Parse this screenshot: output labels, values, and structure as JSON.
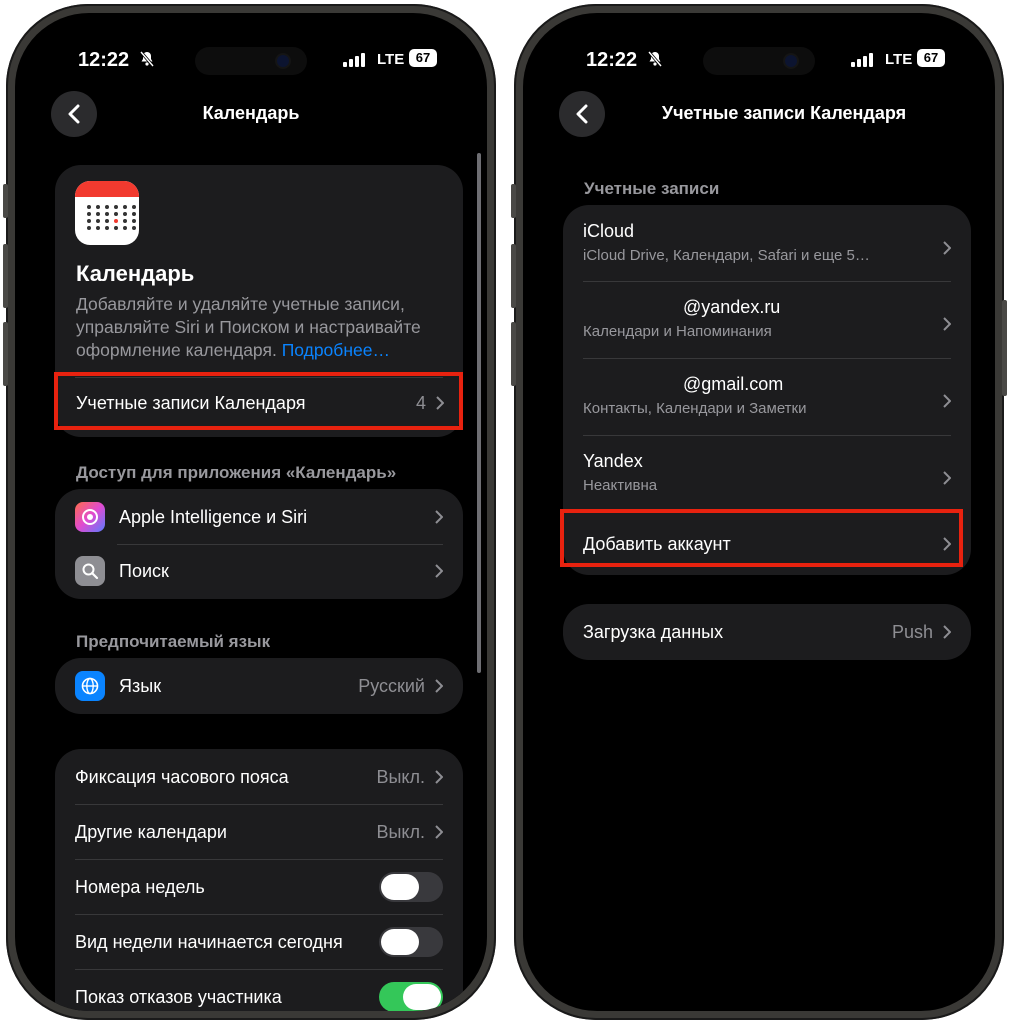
{
  "status": {
    "time": "12:22",
    "network": "LTE",
    "battery": "67"
  },
  "left": {
    "nav_title": "Календарь",
    "app_title": "Календарь",
    "description": "Добавляйте и удаляйте учетные записи, управляйте Siri и Поиском и настраивайте оформление календаря.",
    "more_link": "Подробнее…",
    "accounts_row": {
      "label": "Учетные записи Календаря",
      "value": "4"
    },
    "access_header": "Доступ для приложения «Календарь»",
    "access_items": [
      {
        "label": "Apple Intelligence и Siri",
        "icon": "siri-icon"
      },
      {
        "label": "Поиск",
        "icon": "search-icon"
      }
    ],
    "language_header": "Предпочитаемый язык",
    "language_row": {
      "label": "Язык",
      "value": "Русский"
    },
    "settings": [
      {
        "label": "Фиксация часового пояса",
        "value": "Выкл."
      },
      {
        "label": "Другие календари",
        "value": "Выкл."
      },
      {
        "label": "Номера недель",
        "toggle": false
      },
      {
        "label": "Вид недели начинается сегодня",
        "toggle": false
      },
      {
        "label": "Показ отказов участника",
        "toggle": true
      }
    ]
  },
  "right": {
    "nav_title": "Учетные записи Календаря",
    "accounts_header": "Учетные записи",
    "accounts": [
      {
        "title": "iCloud",
        "subtitle": "iCloud Drive, Календари, Safari и еще 5…"
      },
      {
        "title": "@yandex.ru",
        "subtitle": "Календари и Напоминания"
      },
      {
        "title": "@gmail.com",
        "subtitle": "Контакты, Календари и Заметки"
      },
      {
        "title": "Yandex",
        "subtitle": "Неактивна"
      }
    ],
    "add_account": "Добавить аккаунт",
    "fetch_row": {
      "label": "Загрузка данных",
      "value": "Push"
    }
  },
  "colors": {
    "highlight": "#e8220f",
    "link": "#0a84ff",
    "toggle_on": "#34c759",
    "calendar_red": "#f23a2f"
  }
}
